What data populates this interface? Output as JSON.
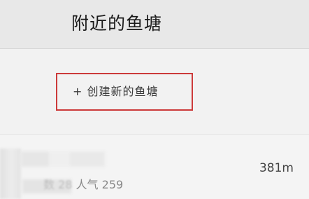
{
  "header": {
    "title": "附近的鱼塘"
  },
  "create": {
    "label": "+ 创建新的鱼塘",
    "border_color": "#cc3a3a"
  },
  "pond_list": {
    "items": [
      {
        "name": "",
        "meta_prefix": "数 28",
        "meta_popularity": "人气 259",
        "distance": "381m"
      }
    ]
  }
}
